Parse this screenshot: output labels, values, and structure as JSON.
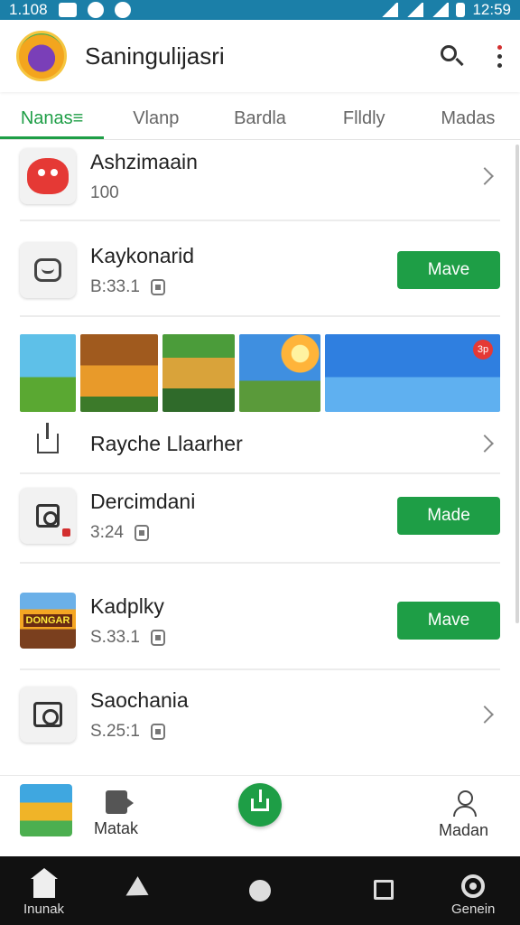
{
  "status_bar": {
    "time_left": "1.108",
    "time_right": "12:59"
  },
  "app_bar": {
    "title": "Saningulijasri"
  },
  "tabs": [
    {
      "label": "Nanas≡"
    },
    {
      "label": "Vlanp"
    },
    {
      "label": "Bardla"
    },
    {
      "label": "Flldly"
    },
    {
      "label": "Madas"
    }
  ],
  "list": {
    "items": [
      {
        "title": "Ashzimaain",
        "subtitle": "100",
        "action": "chevron"
      },
      {
        "title": "Kaykonarid",
        "subtitle": "B:33.1",
        "action": "button",
        "button_label": "Mave"
      },
      {
        "title": "Dercimdani",
        "subtitle": "3:24",
        "action": "button",
        "button_label": "Made"
      },
      {
        "title": "Kadplky",
        "subtitle": "S.33.1",
        "action": "button",
        "button_label": "Mave"
      },
      {
        "title": "Saochania",
        "subtitle": "S.25:1",
        "action": "chevron"
      }
    ],
    "banner_link": {
      "label": "Rayche Llaarher"
    },
    "game_tile_text": "DONGAR",
    "banner_badge": "3p"
  },
  "bottom_bar": {
    "left_label": "Matak",
    "right_label": "Madan"
  },
  "nav_bar": {
    "home_label": "Inunak",
    "right_label": "Genein"
  },
  "colors": {
    "accent": "#1e9e46",
    "status_bar": "#1b7fa8",
    "nav_bar": "#111111"
  }
}
